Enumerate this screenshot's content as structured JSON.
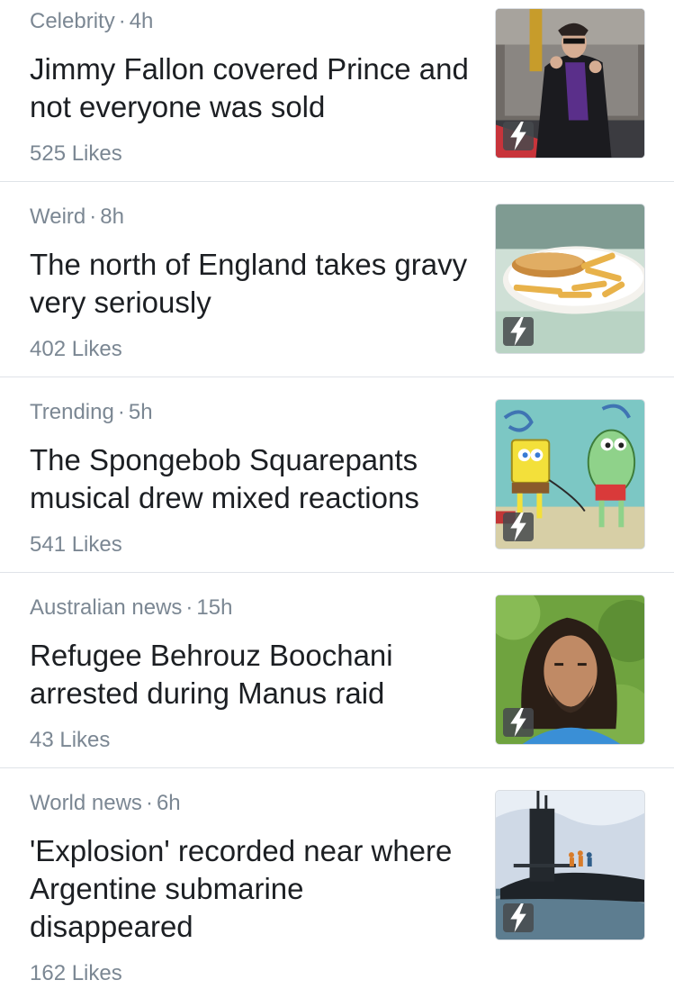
{
  "separator": "·",
  "stories": [
    {
      "category": "Celebrity",
      "age": "4h",
      "headline": "Jimmy Fallon covered Prince and not everyone was sold",
      "likes": "525 Likes",
      "thumb_icon": "bolt-icon"
    },
    {
      "category": "Weird",
      "age": "8h",
      "headline": "The north of England takes gravy very seriously",
      "likes": "402 Likes",
      "thumb_icon": "bolt-icon"
    },
    {
      "category": "Trending",
      "age": "5h",
      "headline": "The Spongebob Squarepants musical drew mixed reactions",
      "likes": "541 Likes",
      "thumb_icon": "bolt-icon"
    },
    {
      "category": "Australian news",
      "age": "15h",
      "headline": "Refugee Behrouz Boochani arrested during Manus raid",
      "likes": "43 Likes",
      "thumb_icon": "bolt-icon"
    },
    {
      "category": "World news",
      "age": "6h",
      "headline": "'Explosion' recorded near where Argentine submarine disappeared",
      "likes": "162 Likes",
      "thumb_icon": "bolt-icon"
    }
  ],
  "colors": {
    "meta_text": "#7b8793",
    "headline_text": "#1c1f23",
    "divider": "#dfe3e8",
    "badge": "#464a4e"
  }
}
